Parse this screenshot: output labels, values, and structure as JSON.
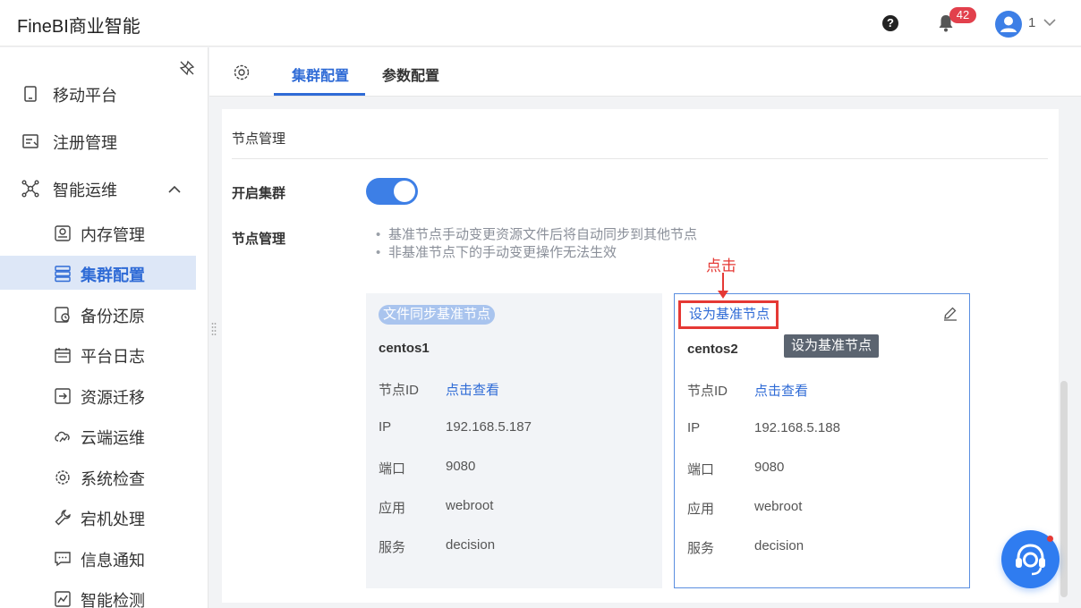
{
  "header": {
    "app_title": "FineBI商业智能",
    "help_symbol": "?",
    "notification_count": "42",
    "user_name": "1",
    "colors": {
      "brand_blue": "#3d7fe6",
      "badge_red": "#e2404c"
    }
  },
  "sidebar": {
    "top_items": [
      {
        "label": "移动平台",
        "icon": "mobile-icon"
      },
      {
        "label": "注册管理",
        "icon": "register-icon"
      },
      {
        "label": "智能运维",
        "icon": "network-icon",
        "expanded": true
      }
    ],
    "sub_items": [
      {
        "label": "内存管理",
        "icon": "memory-icon"
      },
      {
        "label": "集群配置",
        "icon": "cluster-icon",
        "active": true
      },
      {
        "label": "备份还原",
        "icon": "backup-icon"
      },
      {
        "label": "平台日志",
        "icon": "calendar-log-icon"
      },
      {
        "label": "资源迁移",
        "icon": "migrate-icon"
      },
      {
        "label": "云端运维",
        "icon": "cloud-icon"
      },
      {
        "label": "系统检查",
        "icon": "gear-check-icon"
      },
      {
        "label": "宕机处理",
        "icon": "wrench-icon"
      },
      {
        "label": "信息通知",
        "icon": "message-icon"
      },
      {
        "label": "智能检测",
        "icon": "chart-detect-icon"
      }
    ]
  },
  "tabs": [
    {
      "label": "集群配置",
      "active": true
    },
    {
      "label": "参数配置",
      "active": false
    }
  ],
  "main": {
    "section_title": "节点管理",
    "cluster_toggle": {
      "label": "开启集群",
      "on": true
    },
    "node_management": {
      "label": "节点管理",
      "tips": [
        "基准节点手动变更资源文件后将自动同步到其他节点",
        "非基准节点下的手动变更操作无法生效"
      ]
    },
    "nodes": [
      {
        "badge": "文件同步基准节点",
        "name": "centos1",
        "fields": [
          {
            "key": "节点ID",
            "value": "点击查看",
            "link": true
          },
          {
            "key": "IP",
            "value": "192.168.5.187"
          },
          {
            "key": "端口",
            "value": "9080"
          },
          {
            "key": "应用",
            "value": "webroot"
          },
          {
            "key": "服务",
            "value": "decision"
          }
        ]
      },
      {
        "action": "设为基准节点",
        "tooltip": "设为基准节点",
        "name": "centos2",
        "fields": [
          {
            "key": "节点ID",
            "value": "点击查看",
            "link": true
          },
          {
            "key": "IP",
            "value": "192.168.5.188"
          },
          {
            "key": "端口",
            "value": "9080"
          },
          {
            "key": "应用",
            "value": "webroot"
          },
          {
            "key": "服务",
            "value": "decision"
          }
        ]
      }
    ],
    "annotation": "点击"
  }
}
